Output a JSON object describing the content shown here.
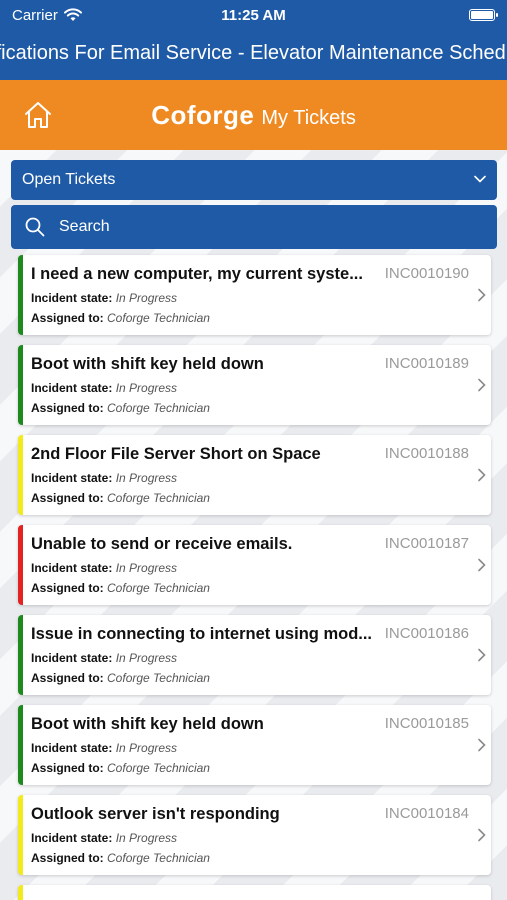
{
  "status": {
    "carrier": "Carrier",
    "time": "11:25 AM",
    "battery_level": 1.0
  },
  "marquee": {
    "text": "Notifications For Email Service - Elevator Maintenance Schedule"
  },
  "header": {
    "brand": "Coforge",
    "title": "My Tickets"
  },
  "filter": {
    "selected": "Open Tickets"
  },
  "search": {
    "placeholder": "Search"
  },
  "labels": {
    "state": "Incident state:",
    "assigned": "Assigned to:"
  },
  "tickets": [
    {
      "title": "I need a new computer, my current syste...",
      "number": "INC0010190",
      "state": "In Progress",
      "assigned": "Coforge Technician",
      "priority_color": "#1e8a1e"
    },
    {
      "title": "Boot with shift key held down",
      "number": "INC0010189",
      "state": "In Progress",
      "assigned": "Coforge Technician",
      "priority_color": "#1e8a1e"
    },
    {
      "title": "2nd Floor File Server Short on Space",
      "number": "INC0010188",
      "state": "In Progress",
      "assigned": "Coforge Technician",
      "priority_color": "#f3ea1b"
    },
    {
      "title": "Unable to send or receive emails.",
      "number": "INC0010187",
      "state": "In Progress",
      "assigned": "Coforge Technician",
      "priority_color": "#e32222"
    },
    {
      "title": "Issue in connecting to internet using mod...",
      "number": "INC0010186",
      "state": "In Progress",
      "assigned": "Coforge Technician",
      "priority_color": "#1e8a1e"
    },
    {
      "title": "Boot with shift key held down",
      "number": "INC0010185",
      "state": "In Progress",
      "assigned": "Coforge Technician",
      "priority_color": "#1e8a1e"
    },
    {
      "title": "Outlook server isn't responding",
      "number": "INC0010184",
      "state": "In Progress",
      "assigned": "Coforge Technician",
      "priority_color": "#f3ea1b"
    }
  ],
  "colors": {
    "primary": "#1f5aa6",
    "brand_orange": "#ef8a22"
  }
}
